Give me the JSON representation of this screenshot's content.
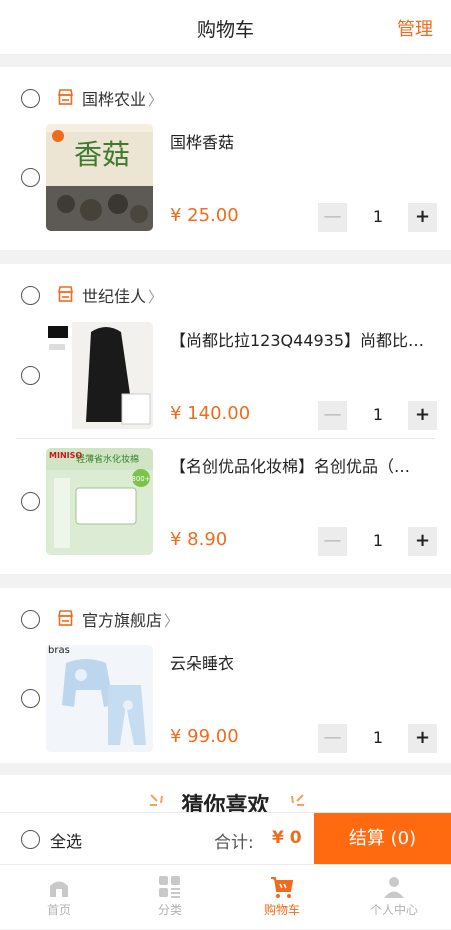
{
  "header": {
    "title": "购物车",
    "manage": "管理"
  },
  "stores": [
    {
      "name": "国桦农业",
      "items": [
        {
          "name": "国桦香菇",
          "price": "¥ 25.00",
          "qty": "1"
        }
      ]
    },
    {
      "name": "世纪佳人",
      "items": [
        {
          "name": "【尚都比拉123Q44935】尚都比…",
          "price": "¥ 140.00",
          "qty": "1"
        },
        {
          "name": "【名创优品化妆棉】名创优品（…",
          "price": "¥ 8.90",
          "qty": "1"
        }
      ]
    },
    {
      "name": "官方旗舰店",
      "items": [
        {
          "name": "云朵睡衣",
          "price": "¥ 99.00",
          "qty": "1"
        }
      ]
    }
  ],
  "thumb_text": {
    "mushroom_brand": "香菇",
    "miniso": "MINISO",
    "cotton": "轻薄省水化妆棉",
    "badge800": "800+",
    "pajama": "bras"
  },
  "qty_controls": {
    "minus": "—",
    "plus": "+"
  },
  "guess": "猜你喜欢",
  "checkout": {
    "select_all": "全选",
    "total_label": "合计:",
    "total_value": "¥ 0",
    "button": "结算 (0)"
  },
  "tabs": [
    "首页",
    "分类",
    "购物车",
    "个人中心"
  ],
  "colors": {
    "accent": "#f26b1d",
    "checkout_button": "#ff6a10"
  },
  "icons": {
    "shop": "shop-icon",
    "chevron": "chevron-right-icon",
    "home": "home-icon",
    "category": "category-icon",
    "cart": "cart-icon",
    "user": "user-icon"
  }
}
